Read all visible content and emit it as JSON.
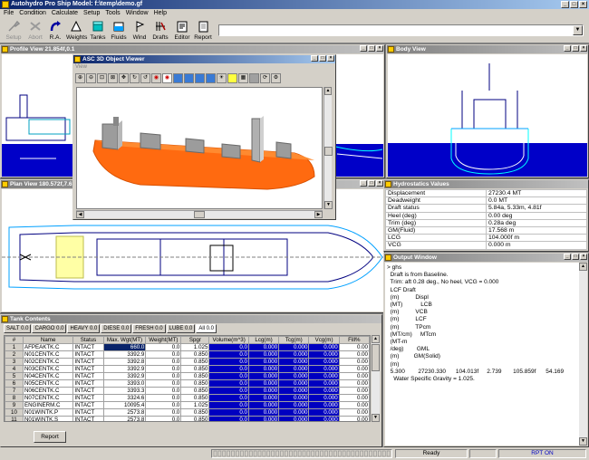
{
  "app": {
    "title": "Autohydro Pro   Ship Model: f:\\temp\\demo.gf"
  },
  "menu": [
    "File",
    "Condition",
    "Calculate",
    "Setup",
    "Tools",
    "Window",
    "Help"
  ],
  "toolbar": [
    {
      "label": "Setup",
      "icon": "wrench-icon",
      "enabled": false
    },
    {
      "label": "Abort",
      "icon": "abort-icon",
      "enabled": false
    },
    {
      "label": "R.A.",
      "icon": "redo-arrow-icon",
      "enabled": true
    },
    {
      "label": "Weights",
      "icon": "weights-icon",
      "enabled": true
    },
    {
      "label": "Tanks",
      "icon": "tank-icon",
      "enabled": true
    },
    {
      "label": "Fluids",
      "icon": "fluids-icon",
      "enabled": true
    },
    {
      "label": "Wind",
      "icon": "wind-icon",
      "enabled": true
    },
    {
      "label": "Drafts",
      "icon": "drafts-icon",
      "enabled": true
    },
    {
      "label": "Editor",
      "icon": "editor-icon",
      "enabled": true
    },
    {
      "label": "Report",
      "icon": "report-icon",
      "enabled": true
    }
  ],
  "windows": {
    "profile": "Profile View 21.854f,0.1",
    "viewer": "ASC 3D Object Viewer",
    "viewer_menu": "View",
    "body": "Body View",
    "plan": "Plan View 180.572f,7.61",
    "hydro": "Hydrostatics Values",
    "output": "Output Window",
    "tanks": "Tank Contents"
  },
  "hydrostatics": [
    {
      "label": "Displacement",
      "value": "27230.4 MT"
    },
    {
      "label": "Deadweight",
      "value": "0.0 MT"
    },
    {
      "label": "Draft status",
      "value": "5.84a, 5.33m, 4.81f"
    },
    {
      "label": "Heel (deg)",
      "value": "0.00  deg"
    },
    {
      "label": "Trim (deg)",
      "value": "0.28a deg"
    },
    {
      "label": "GM(Fluid)",
      "value": "17.568 m"
    },
    {
      "label": "LCG",
      "value": "104.000f m"
    },
    {
      "label": "VCG",
      "value": "0.000 m"
    }
  ],
  "output_lines": [
    "> ghs",
    "  Draft is from Baseline.",
    "  Trim: aft 0.28 deg., No heel, VCG = 0.000",
    "  LCF Draft",
    "  (m)          Displ",
    "  (MT)           LCB",
    "  (m)          VCB",
    "  (m)          LCF",
    "  (m)          TPcm",
    "  (MT/cm)     MTcm",
    "  (MT-m",
    "  /deg)        GML",
    "  (m)         GM(Solid)",
    "  (m)",
    "  5.300        27230.330      104.013f     2.739       105.859f      54.169",
    "    Water Specific Gravity = 1.025."
  ],
  "tank_tabs": [
    "SALT 0.0",
    "CARGO 0.0",
    "HEAVY 0.0",
    "DIESE 0.0",
    "FRESH 0.0",
    "LUBE 0.0",
    "All 0.0"
  ],
  "tank_columns": [
    "#",
    "Name",
    "Status",
    "Max. Wgt(MT)",
    "Weight(MT)",
    "Spgr",
    "Volume(m^3)",
    "Lcg(m)",
    "Tcg(m)",
    "Vcg(m)",
    "Fill%"
  ],
  "tank_rows": [
    [
      "1",
      "AFPEAKTK.C",
      "INTACT",
      "660.0",
      "0.0",
      "1.025",
      "0.0",
      "0.000",
      "0.000",
      "0.000",
      "0.00"
    ],
    [
      "2",
      "N01CENTK.C",
      "INTACT",
      "3392.9",
      "0.0",
      "0.850",
      "0.0",
      "0.000",
      "0.000",
      "0.000",
      "0.00"
    ],
    [
      "3",
      "N02CENTK.C",
      "INTACT",
      "3392.8",
      "0.0",
      "0.850",
      "0.0",
      "0.000",
      "0.000",
      "0.000",
      "0.00"
    ],
    [
      "4",
      "N03CENTK.C",
      "INTACT",
      "3392.9",
      "0.0",
      "0.850",
      "0.0",
      "0.000",
      "0.000",
      "0.000",
      "0.00"
    ],
    [
      "5",
      "N04CENTK.C",
      "INTACT",
      "3392.9",
      "0.0",
      "0.850",
      "0.0",
      "0.000",
      "0.000",
      "0.000",
      "0.00"
    ],
    [
      "6",
      "N05CENTK.C",
      "INTACT",
      "3393.0",
      "0.0",
      "0.850",
      "0.0",
      "0.000",
      "0.000",
      "0.000",
      "0.00"
    ],
    [
      "7",
      "N06CENTK.C",
      "INTACT",
      "3393.3",
      "0.0",
      "0.850",
      "0.0",
      "0.000",
      "0.000",
      "0.000",
      "0.00"
    ],
    [
      "8",
      "N07CENTK.C",
      "INTACT",
      "3324.6",
      "0.0",
      "0.850",
      "0.0",
      "0.000",
      "0.000",
      "0.000",
      "0.00"
    ],
    [
      "9",
      "ENGINERM.C",
      "INTACT",
      "10095.4",
      "0.0",
      "1.025",
      "0.0",
      "0.000",
      "0.000",
      "0.000",
      "0.00"
    ],
    [
      "10",
      "N01WINTK.P",
      "INTACT",
      "2573.8",
      "0.0",
      "0.850",
      "0.0",
      "0.000",
      "0.000",
      "0.000",
      "0.00"
    ],
    [
      "11",
      "N01WINTK.S",
      "INTACT",
      "2573.8",
      "0.0",
      "0.850",
      "0.0",
      "0.000",
      "0.000",
      "0.000",
      "0.00"
    ]
  ],
  "report_button": "Report",
  "status": {
    "ready": "Ready",
    "rpt": "RPT ON"
  },
  "colors": {
    "hull": "#ff6a10",
    "superstructure": "#9c9c9c",
    "water": "#0000c8",
    "selected_cell": "#0a246a"
  }
}
